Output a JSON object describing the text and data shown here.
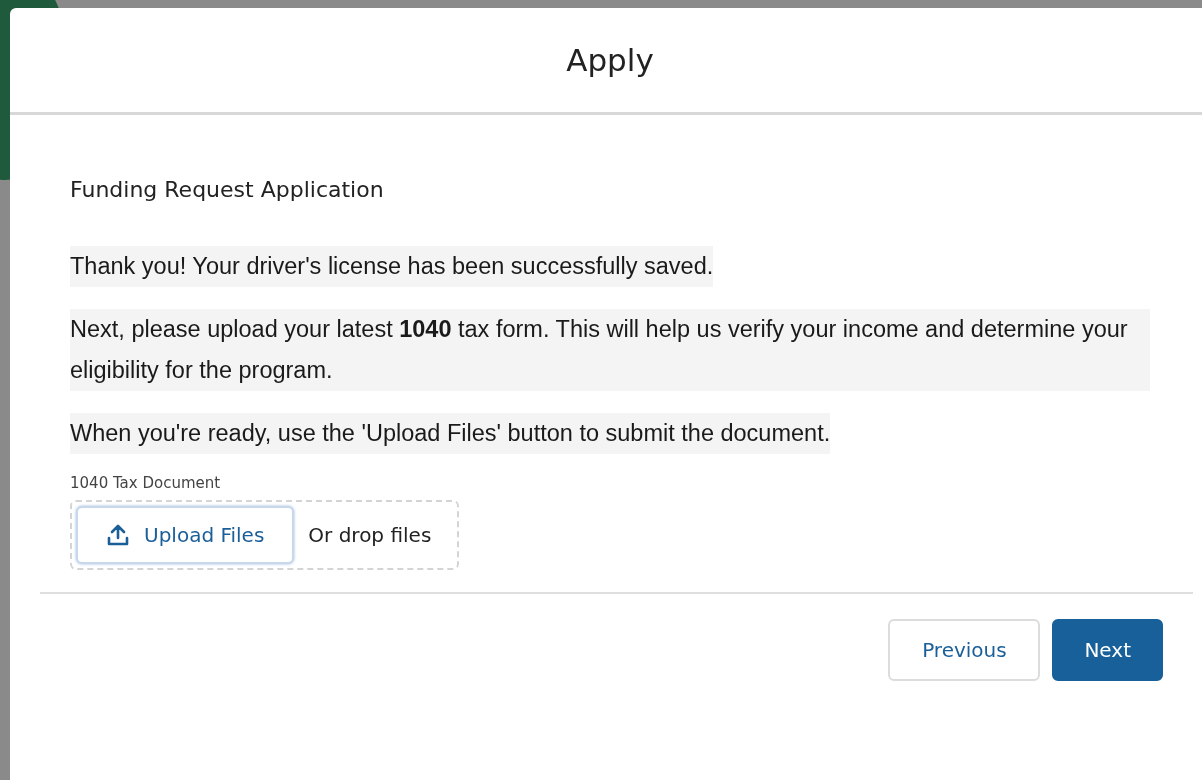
{
  "modal": {
    "title": "Apply"
  },
  "form_title": "Funding Request Application",
  "paragraphs": [
    "Thank you! Your driver's license has been successfully saved.",
    "Next, please upload your latest **1040** tax form. This will help us verify your income and determine your eligibility for the program.",
    "When you're ready, use the 'Upload Files' button to submit the document."
  ],
  "upload": {
    "label": "1040 Tax Document",
    "button": "Upload Files",
    "drop_text": "Or drop files"
  },
  "buttons": [
    {
      "label": "Previous",
      "kind": "neutral"
    },
    {
      "label": "Next",
      "kind": "brand"
    }
  ]
}
